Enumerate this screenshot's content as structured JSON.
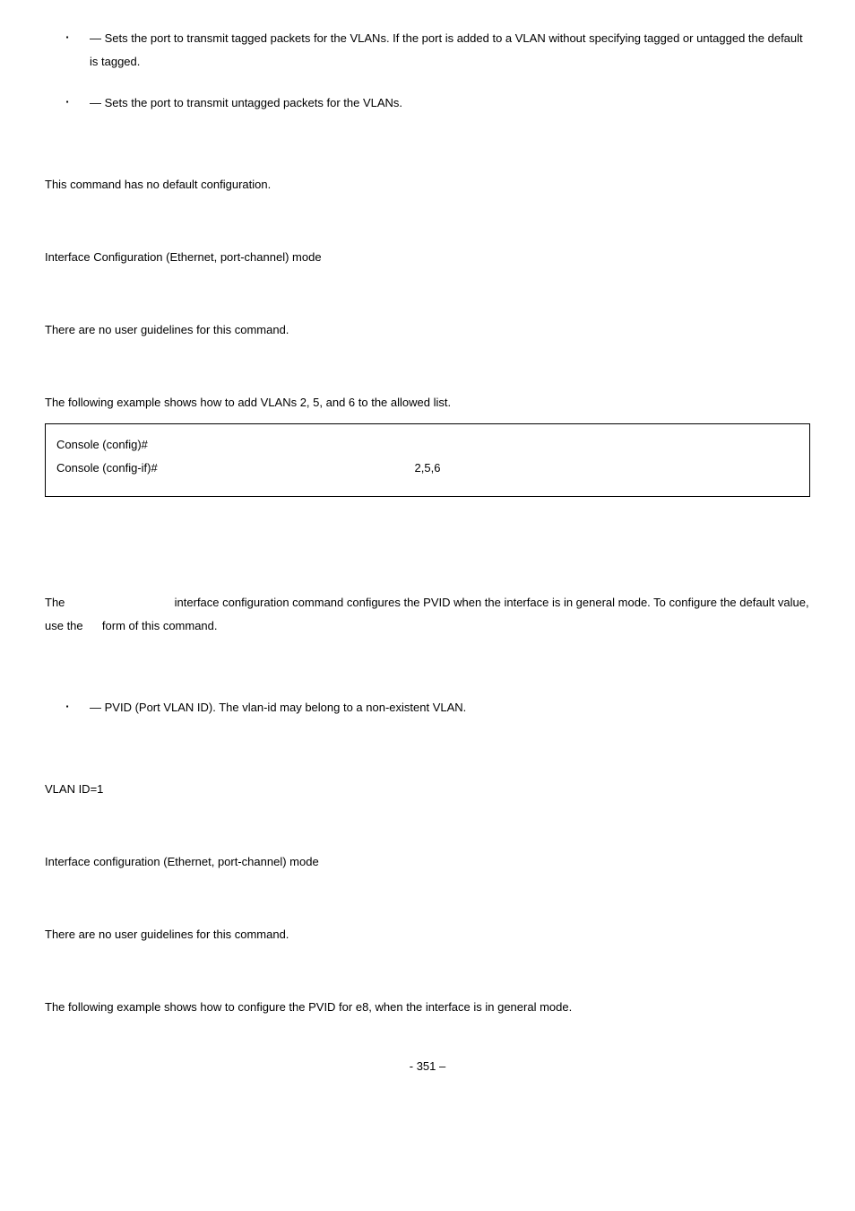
{
  "bullets1": {
    "item1": "— Sets the port to transmit tagged packets for the VLANs. If the port is added to a VLAN without specifying tagged or untagged the default is tagged.",
    "item2": "— Sets the port to transmit untagged packets for the VLANs."
  },
  "para1": "This command has no default configuration.",
  "para2": "Interface Configuration (Ethernet, port-channel) mode",
  "para3": "There are no user guidelines for this command.",
  "para4": "The following example shows how to add VLANs 2, 5, and 6 to the allowed list.",
  "codebox": {
    "line1": "Console (config)#",
    "line2_left": "Console (config-if)#",
    "line2_mid": "2,5,6"
  },
  "para5_pre": "The",
  "para5_mid": "interface configuration command configures the PVID when the interface is in general mode. To configure the default value, use the",
  "para5_post": "form of this command.",
  "bullets2": {
    "item1": "— PVID (Port VLAN ID). The vlan-id may belong to a non-existent VLAN."
  },
  "para6": "VLAN ID=1",
  "para7": "Interface configuration (Ethernet, port-channel) mode",
  "para8": "There are no user guidelines for this command.",
  "para9": "The following example shows how to configure the PVID for e8, when the interface is in general mode.",
  "footer": "- 351 –"
}
